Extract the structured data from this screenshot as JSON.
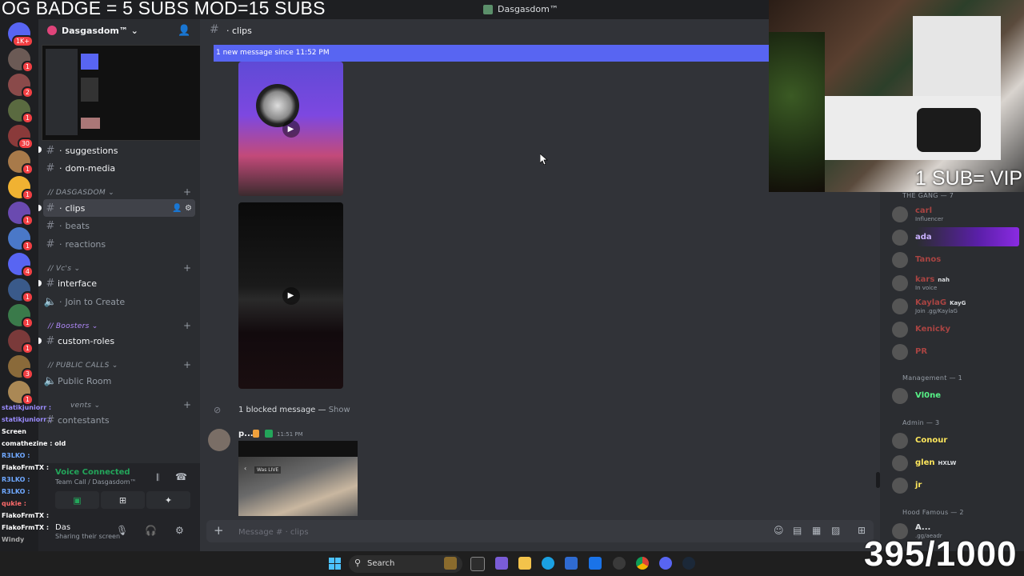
{
  "overlays": {
    "top_banner": "OG BADGE = 5 SUBS   MOD=15 SUBS",
    "vip_text": "1 SUB= VIP",
    "sub_counter": "395/1000"
  },
  "window": {
    "title": "Dasgasdom™"
  },
  "server_rail": {
    "badges": [
      "1K+",
      "1",
      "2",
      "1",
      "30",
      "1",
      "1",
      "1",
      "1",
      "4",
      "1",
      "1",
      "1",
      "3",
      "1"
    ]
  },
  "guild": {
    "name": "Dasgasdom™ ⌄"
  },
  "channels": {
    "suggestions": "suggestions",
    "dom_media": "dom-media",
    "cat_dasgasdom": "// DASGASDOM ⌄",
    "clips": "clips",
    "beats": "beats",
    "reactions": "reactions",
    "cat_vcs": "// Vc's ⌄",
    "interface": "interface",
    "join_to_create": "Join to Create",
    "cat_boosters": "// Boosters ⌄",
    "custom_roles": "custom-roles",
    "cat_public_calls": "// PUBLIC CALLS ⌄",
    "public_room": "Public Room",
    "cat_events": "vents ⌄",
    "contestants": "contestants"
  },
  "stream_chat": [
    {
      "user": "statikjuniorr :",
      "color": "#9b8cff"
    },
    {
      "user": "statikjuniorr :",
      "color": "#9b8cff"
    },
    {
      "user": "Screen",
      "color": "#ffffff"
    },
    {
      "user": "comathezine : old",
      "color": "#ffffff"
    },
    {
      "user": "R3LKO :",
      "color": "#6fa8ff"
    },
    {
      "user": "FlakoFrmTX :",
      "color": "#ffffff"
    },
    {
      "user": "R3LKO :",
      "color": "#6fa8ff"
    },
    {
      "user": "R3LKO :",
      "color": "#6fa8ff"
    },
    {
      "user": "qukie :",
      "color": "#ff6b6b"
    },
    {
      "user": "FlakoFrmTX :",
      "color": "#ffffff"
    },
    {
      "user": "FlakoFrmTX :",
      "color": "#ffffff"
    },
    {
      "user": "Windy",
      "color": "#aaaaaa"
    }
  ],
  "voice": {
    "status": "Voice Connected",
    "channel": "Team Call / Dasgasdom™"
  },
  "user": {
    "name": "Das",
    "status": "Sharing their screen"
  },
  "main": {
    "channel_name": "clips",
    "new_messages": "1 new message since 11:52 PM",
    "blocked": "1 blocked message — ",
    "blocked_show": "Show",
    "author": "p...",
    "timestamp": "11:51 PM",
    "was_live": "Was LIVE",
    "composer_placeholder": "Message # · clips"
  },
  "members": {
    "gang_header": "THE GANG — 7",
    "gang": [
      {
        "name": "carl",
        "sub": "Influencer",
        "color": "#a94442"
      },
      {
        "name": "ada",
        "sub": "",
        "color": "#c9b0ff"
      },
      {
        "name": "Tanos",
        "sub": "",
        "color": "#a94442"
      },
      {
        "name": "kars",
        "tag": "nah",
        "sub": "In voice",
        "color": "#a94442"
      },
      {
        "name": "KaylaG",
        "tag": "KayG",
        "sub": "Join .gg/KaylaG",
        "color": "#a94442"
      },
      {
        "name": "Kenicky",
        "sub": "",
        "color": "#a94442"
      },
      {
        "name": "PR",
        "sub": "",
        "color": "#a94442"
      }
    ],
    "mgmt_header": "Management — 1",
    "mgmt": [
      {
        "name": "Vl0ne",
        "color": "#57f287"
      }
    ],
    "admin_header": "Admin — 3",
    "admin": [
      {
        "name": "Conour",
        "color": "#fee75c"
      },
      {
        "name": "glen",
        "tag": "HXLW",
        "color": "#fee75c"
      },
      {
        "name": "jr",
        "color": "#fee75c"
      }
    ],
    "hood_header": "Hood Famous — 2",
    "hood": [
      {
        "name": "A...",
        "sub": ".gg/aeadr",
        "color": "#dbdee1"
      }
    ]
  },
  "taskbar": {
    "search": "Search"
  }
}
